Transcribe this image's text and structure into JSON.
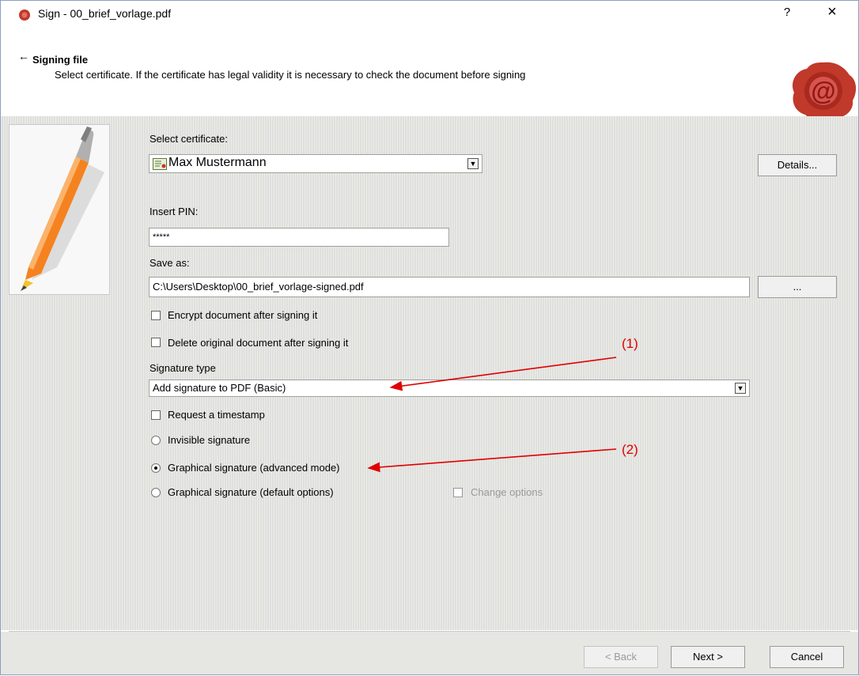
{
  "window": {
    "title": "Sign - 00_brief_vorlage.pdf",
    "help_label": "?",
    "close_label": "×"
  },
  "header": {
    "back_arrow": "←",
    "title": "Signing file",
    "description": "Select certificate. If the certificate has legal validity it is necessary to check the document before signing"
  },
  "form": {
    "certificate_label": "Select certificate:",
    "certificate_value": "Max Mustermann",
    "details_button": "Details...",
    "pin_label": "Insert PIN:",
    "pin_value": "*****",
    "save_as_label": "Save as:",
    "save_as_value": "C:\\Users\\Desktop\\00_brief_vorlage-signed.pdf",
    "browse_button": "...",
    "encrypt_label": "Encrypt document after signing it",
    "encrypt_checked": false,
    "delete_label": "Delete original document after signing it",
    "delete_checked": false,
    "signature_type_label": "Signature type",
    "signature_type_value": "Add signature to PDF (Basic)",
    "timestamp_label": "Request a timestamp",
    "timestamp_checked": false,
    "radio_invisible": "Invisible signature",
    "radio_graphical_advanced": "Graphical signature (advanced mode)",
    "radio_graphical_default": "Graphical signature (default options)",
    "selected_radio": "graphical_advanced",
    "change_options_label": "Change options"
  },
  "annotations": {
    "label_1": "(1)",
    "label_2": "(2)"
  },
  "footer": {
    "back_button": "< Back",
    "next_button": "Next >",
    "cancel_button": "Cancel"
  },
  "icons": {
    "app": "wax-seal-icon",
    "header_logo": "wax-seal-at-icon",
    "pen": "pen-icon",
    "certificate": "certificate-icon"
  },
  "colors": {
    "annotation": "#e00000",
    "seal": "#c0392b"
  }
}
